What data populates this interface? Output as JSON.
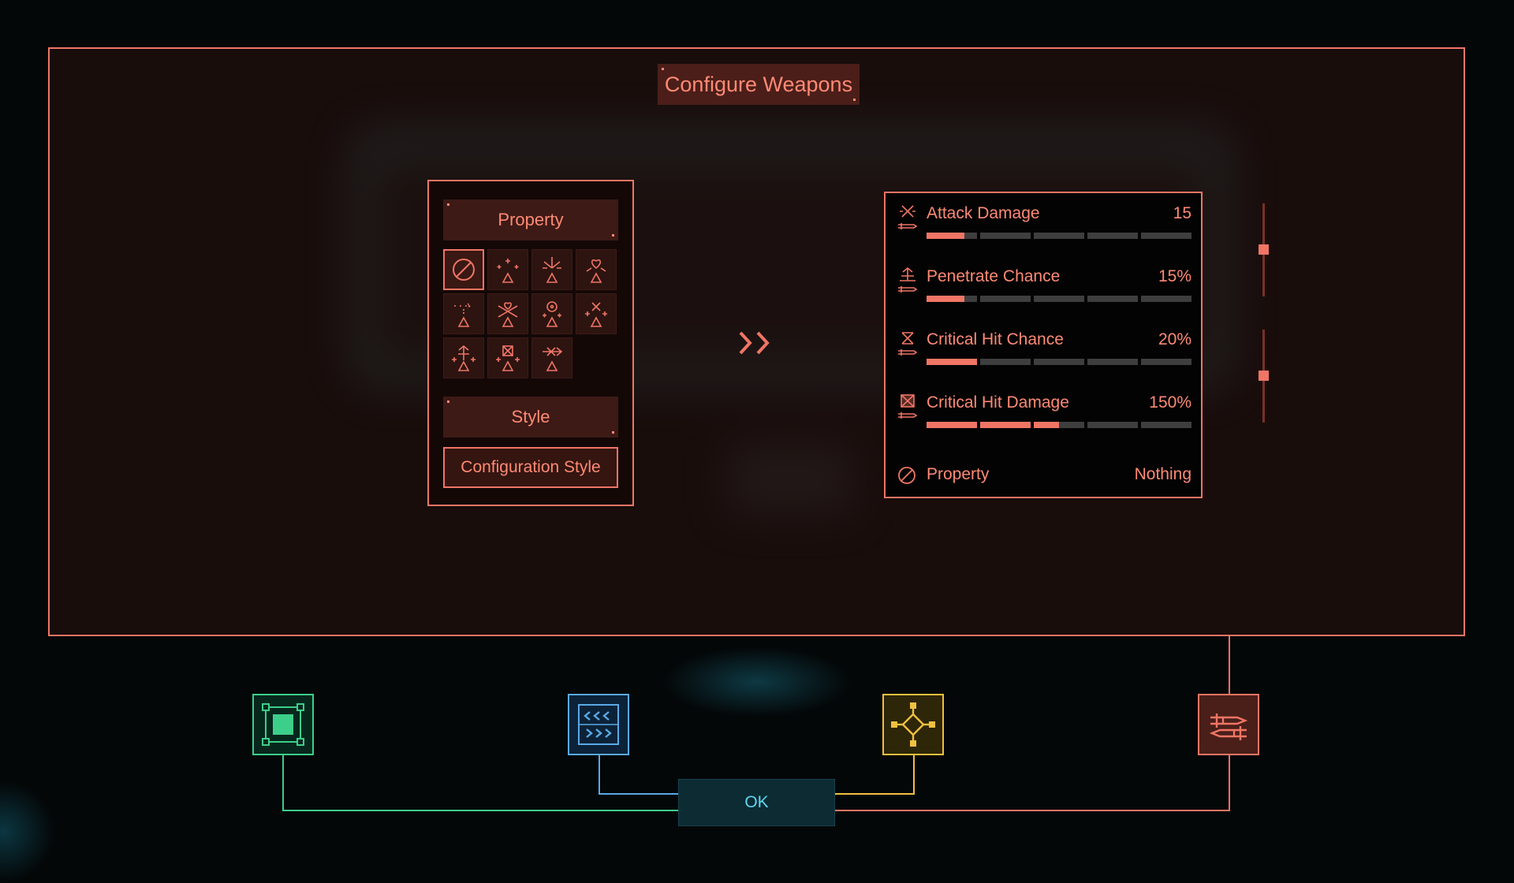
{
  "title": "Configure Weapons",
  "config_panel": {
    "property_header": "Property",
    "style_header": "Style",
    "style_button": "Configuration Style",
    "property_icons": [
      {
        "name": "none-icon",
        "selected": true
      },
      {
        "name": "sparkle-icon",
        "selected": false
      },
      {
        "name": "burst-icon",
        "selected": false
      },
      {
        "name": "heart-icon",
        "selected": false
      },
      {
        "name": "dash-icon",
        "selected": false
      },
      {
        "name": "heart-cross-icon",
        "selected": false
      },
      {
        "name": "target-icon",
        "selected": false
      },
      {
        "name": "cross-plus-icon",
        "selected": false
      },
      {
        "name": "pierce-icon",
        "selected": false
      },
      {
        "name": "critical-icon",
        "selected": false
      },
      {
        "name": "arrow-cross-icon",
        "selected": false
      }
    ]
  },
  "stats": [
    {
      "label": "Attack Damage",
      "value": "15",
      "level": 0.15,
      "icon": "attack-damage-icon"
    },
    {
      "label": "Penetrate Chance",
      "value": "15%",
      "level": 0.15,
      "icon": "penetrate-icon"
    },
    {
      "label": "Critical Hit Chance",
      "value": "20%",
      "level": 0.2,
      "icon": "crit-chance-icon"
    },
    {
      "label": "Critical Hit Damage",
      "value": "150%",
      "level": 0.5,
      "icon": "crit-damage-icon"
    }
  ],
  "property_row": {
    "label": "Property",
    "value": "Nothing"
  },
  "ok_label": "OK",
  "colors": {
    "accent": "#f07565",
    "panel_bg": "#190d0c",
    "green_node": "#3ccf8a",
    "blue_node": "#5aa9e6",
    "yellow_node": "#f0c040",
    "red_node": "#f07565",
    "ok_text": "#5fd6f0"
  }
}
